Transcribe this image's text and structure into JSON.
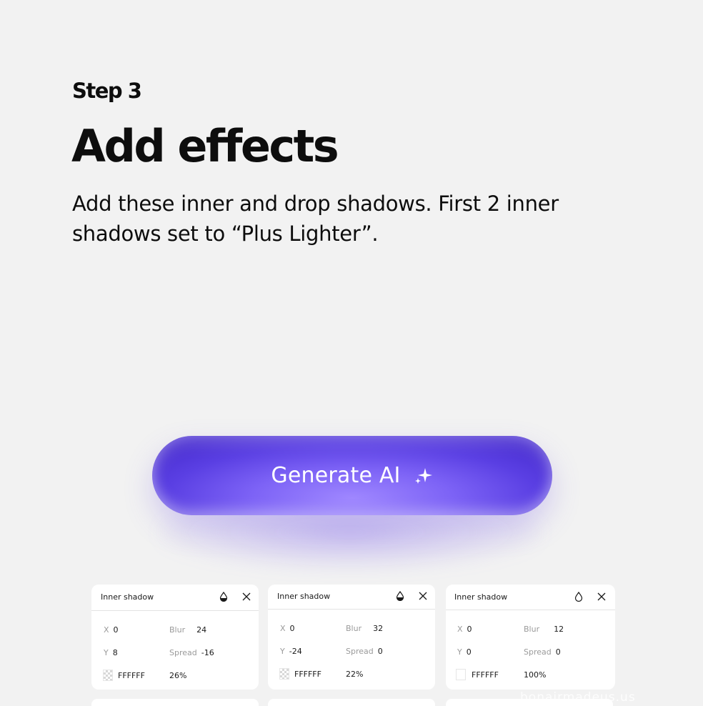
{
  "heading": {
    "step": "Step 3",
    "title": "Add effects",
    "description": "Add these inner and drop shadows. First 2 inner shadows set to “Plus Lighter”."
  },
  "button": {
    "label": "Generate AI",
    "icon": "sparkle-icon",
    "colors": {
      "center": "#9f87ff",
      "edge": "#4a2fd2"
    }
  },
  "cards": [
    {
      "title": "Inner shadow",
      "x": "0",
      "y": "8",
      "blur": "24",
      "spread": "-16",
      "color": "FFFFFF",
      "opacity": "26%",
      "labels": {
        "x": "X",
        "y": "Y",
        "blur": "Blur",
        "spread": "Spread"
      }
    },
    {
      "title": "Inner shadow",
      "x": "0",
      "y": "-24",
      "blur": "32",
      "spread": "0",
      "color": "FFFFFF",
      "opacity": "22%",
      "labels": {
        "x": "X",
        "y": "Y",
        "blur": "Blur",
        "spread": "Spread"
      }
    },
    {
      "title": "Inner shadow",
      "x": "0",
      "y": "0",
      "blur": "12",
      "spread": "0",
      "color": "FFFFFF",
      "opacity": "100%",
      "labels": {
        "x": "X",
        "y": "Y",
        "blur": "Blur",
        "spread": "Spread"
      }
    }
  ],
  "watermark": "bonairmadeus.us"
}
